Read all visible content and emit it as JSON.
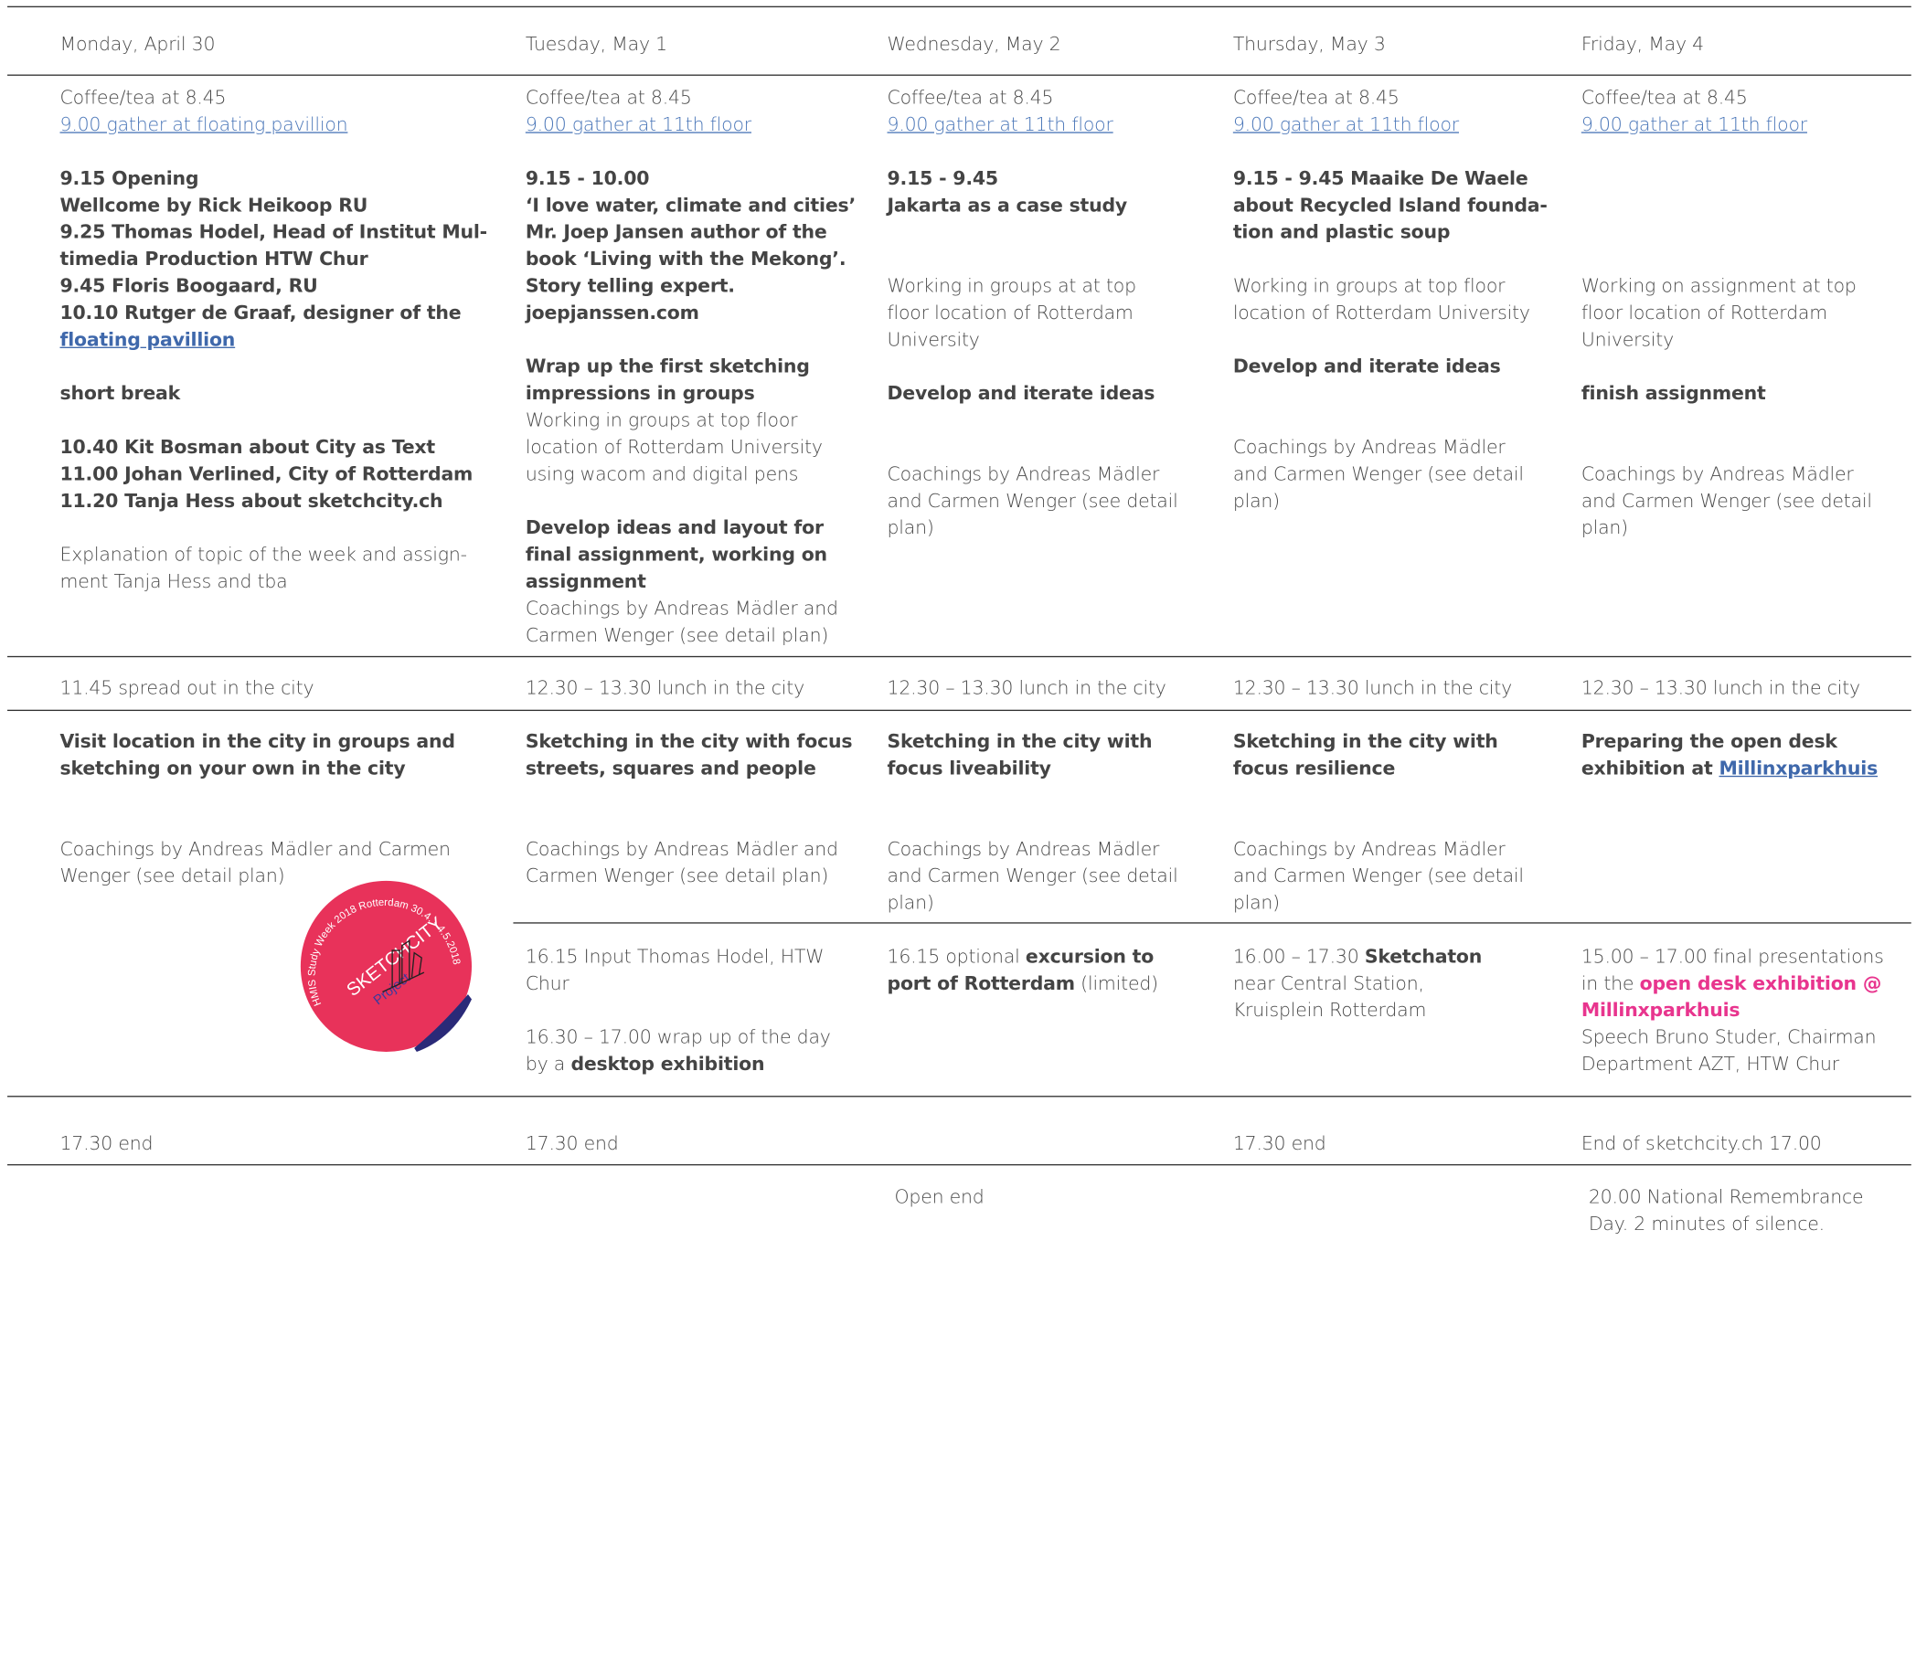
{
  "days": [
    "Monday, April 30",
    "Tuesday, May 1",
    "Wednesday, May 2",
    "Thursday, May 3",
    "Friday, May 4"
  ],
  "common": {
    "coffee": "Coffee/tea at 8.45",
    "gather_11th": "9.00 gather at 11th floor",
    "coachings": "Coachings by Andreas Mädler and Carmen Wenger (see detail plan)",
    "develop_iterate": "Develop and iterate ideas",
    "lunch": "12.30 – 13.30 lunch in the city",
    "end": "17.30 end"
  },
  "mon": {
    "gather": "9.00 gather at floating pavillion",
    "l1": "9.15 Opening",
    "l2": "Wellcome by Rick Heikoop RU",
    "l3": "9.25 Thomas Hodel, Head of Institut Mul-",
    "l4": "timedia Production HTW Chur",
    "l5": "9.45 Floris Boogaard, RU",
    "l6": "10.10 Rutger de Graaf, designer of the",
    "l7": "floating pavillion",
    "l8": "short break",
    "l9": "10.40 Kit Bosman about City as Text",
    "l10": "11.00 Johan Verlined, City of Rotterdam",
    "l11": "11.20 Tanja Hess about sketchcity.ch",
    "l12": "Explanation of topic of the week and assign-",
    "l13": "ment Tanja Hess and tba",
    "lunch": "11.45  spread out in the city",
    "pm1": "Visit location in the city in groups and",
    "pm2": "sketching on your own in the city",
    "c1": "Coachings by Andreas Mädler and Carmen",
    "c2": "Wenger (see detail plan)"
  },
  "tue": {
    "l1": "9.15 - 10.00",
    "l2": "‘I love water, climate and cities’",
    "l3": "Mr. Joep Jansen author of the",
    "l4": "book ‘Living with the Mekong’.",
    "l5": "Story telling expert.",
    "l6": "joepjanssen.com",
    "l7": "Wrap up the first sketching",
    "l8": "impressions in groups",
    "l9": "Working in groups at top floor",
    "l10": "location of Rotterdam University",
    "l11": "using wacom and digital pens",
    "l12": "Develop ideas and layout for",
    "l13": "final assignment, working on",
    "l14": "assignment",
    "c1": "Coachings by Andreas Mädler and",
    "c2": "Carmen Wenger (see detail plan)",
    "pm1": "Sketching in the city with focus",
    "pm2": "streets, squares and people",
    "e1": "16.15 Input Thomas Hodel, HTW",
    "e2": "Chur",
    "e3": "16.30 – 17.00 wrap up of the day",
    "e4a": "by a ",
    "e4b": "desktop exhibition"
  },
  "wed": {
    "l1": "9.15 - 9.45",
    "l2": "Jakarta as a case study",
    "w1": "Working in groups at at top",
    "w2": "floor location of Rotterdam",
    "w3": "University",
    "c1": "Coachings by Andreas Mädler",
    "c2": "and Carmen Wenger (see detail",
    "c3": "plan)",
    "pm1": "Sketching in the city with",
    "pm2": "focus liveability",
    "e1a": "16.15 optional ",
    "e1b": "excursion to",
    "e2a": "port of Rotterdam",
    "e2b": " (limited)",
    "open": "Open end"
  },
  "thu": {
    "l1": "9.15 - 9.45 Maaike De Waele",
    "l2": "about Recycled Island founda-",
    "l3": "tion and plastic soup",
    "w1": "Working in groups at top floor",
    "w2": "location of Rotterdam University",
    "pm1": "Sketching in the city with",
    "pm2": "focus resilience",
    "e1a": "16.00 – 17.30 ",
    "e1b": "Sketchaton",
    "e2": "near Central Station,",
    "e3": "Kruisplein Rotterdam"
  },
  "fri": {
    "w1": "Working on assignment at top",
    "w2": "floor location of Rotterdam",
    "w3": "University",
    "finish": "finish assignment",
    "pm1": "Preparing the open desk",
    "pm2a": "exhibition at ",
    "pm2b": "Millinxparkhuis",
    "e1": "15.00 – 17.00 final presentations",
    "e2a": "in the ",
    "e2b": "open desk exhibition @",
    "e3": "Millinxparkhuis",
    "e4": "Speech Bruno Studer, Chairman",
    "e5": "Department AZT, HTW Chur",
    "end": "End of sketchcity.ch 17.00",
    "n1": "20.00 National Remembrance",
    "n2": "Day. 2 minutes of silence."
  },
  "sticker": {
    "ring": "HMIS Study Week 2018 Rotterdam 30.4. - 4.5.2018",
    "logo": "SKETCHCITY",
    "sub": "Project"
  },
  "colors": {
    "link": "#4a76b8",
    "pink": "#e8358e",
    "sticker": "#e8325a",
    "sticker_curl": "#3a3a9e"
  }
}
